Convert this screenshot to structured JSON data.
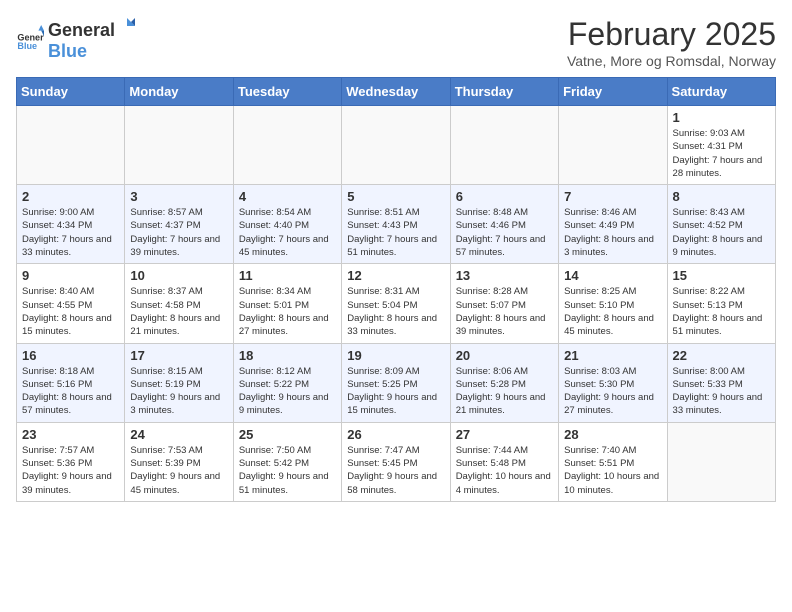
{
  "header": {
    "logo_general": "General",
    "logo_blue": "Blue",
    "month_title": "February 2025",
    "location": "Vatne, More og Romsdal, Norway"
  },
  "days_of_week": [
    "Sunday",
    "Monday",
    "Tuesday",
    "Wednesday",
    "Thursday",
    "Friday",
    "Saturday"
  ],
  "weeks": [
    [
      {
        "day": "",
        "info": ""
      },
      {
        "day": "",
        "info": ""
      },
      {
        "day": "",
        "info": ""
      },
      {
        "day": "",
        "info": ""
      },
      {
        "day": "",
        "info": ""
      },
      {
        "day": "",
        "info": ""
      },
      {
        "day": "1",
        "info": "Sunrise: 9:03 AM\nSunset: 4:31 PM\nDaylight: 7 hours and 28 minutes."
      }
    ],
    [
      {
        "day": "2",
        "info": "Sunrise: 9:00 AM\nSunset: 4:34 PM\nDaylight: 7 hours and 33 minutes."
      },
      {
        "day": "3",
        "info": "Sunrise: 8:57 AM\nSunset: 4:37 PM\nDaylight: 7 hours and 39 minutes."
      },
      {
        "day": "4",
        "info": "Sunrise: 8:54 AM\nSunset: 4:40 PM\nDaylight: 7 hours and 45 minutes."
      },
      {
        "day": "5",
        "info": "Sunrise: 8:51 AM\nSunset: 4:43 PM\nDaylight: 7 hours and 51 minutes."
      },
      {
        "day": "6",
        "info": "Sunrise: 8:48 AM\nSunset: 4:46 PM\nDaylight: 7 hours and 57 minutes."
      },
      {
        "day": "7",
        "info": "Sunrise: 8:46 AM\nSunset: 4:49 PM\nDaylight: 8 hours and 3 minutes."
      },
      {
        "day": "8",
        "info": "Sunrise: 8:43 AM\nSunset: 4:52 PM\nDaylight: 8 hours and 9 minutes."
      }
    ],
    [
      {
        "day": "9",
        "info": "Sunrise: 8:40 AM\nSunset: 4:55 PM\nDaylight: 8 hours and 15 minutes."
      },
      {
        "day": "10",
        "info": "Sunrise: 8:37 AM\nSunset: 4:58 PM\nDaylight: 8 hours and 21 minutes."
      },
      {
        "day": "11",
        "info": "Sunrise: 8:34 AM\nSunset: 5:01 PM\nDaylight: 8 hours and 27 minutes."
      },
      {
        "day": "12",
        "info": "Sunrise: 8:31 AM\nSunset: 5:04 PM\nDaylight: 8 hours and 33 minutes."
      },
      {
        "day": "13",
        "info": "Sunrise: 8:28 AM\nSunset: 5:07 PM\nDaylight: 8 hours and 39 minutes."
      },
      {
        "day": "14",
        "info": "Sunrise: 8:25 AM\nSunset: 5:10 PM\nDaylight: 8 hours and 45 minutes."
      },
      {
        "day": "15",
        "info": "Sunrise: 8:22 AM\nSunset: 5:13 PM\nDaylight: 8 hours and 51 minutes."
      }
    ],
    [
      {
        "day": "16",
        "info": "Sunrise: 8:18 AM\nSunset: 5:16 PM\nDaylight: 8 hours and 57 minutes."
      },
      {
        "day": "17",
        "info": "Sunrise: 8:15 AM\nSunset: 5:19 PM\nDaylight: 9 hours and 3 minutes."
      },
      {
        "day": "18",
        "info": "Sunrise: 8:12 AM\nSunset: 5:22 PM\nDaylight: 9 hours and 9 minutes."
      },
      {
        "day": "19",
        "info": "Sunrise: 8:09 AM\nSunset: 5:25 PM\nDaylight: 9 hours and 15 minutes."
      },
      {
        "day": "20",
        "info": "Sunrise: 8:06 AM\nSunset: 5:28 PM\nDaylight: 9 hours and 21 minutes."
      },
      {
        "day": "21",
        "info": "Sunrise: 8:03 AM\nSunset: 5:30 PM\nDaylight: 9 hours and 27 minutes."
      },
      {
        "day": "22",
        "info": "Sunrise: 8:00 AM\nSunset: 5:33 PM\nDaylight: 9 hours and 33 minutes."
      }
    ],
    [
      {
        "day": "23",
        "info": "Sunrise: 7:57 AM\nSunset: 5:36 PM\nDaylight: 9 hours and 39 minutes."
      },
      {
        "day": "24",
        "info": "Sunrise: 7:53 AM\nSunset: 5:39 PM\nDaylight: 9 hours and 45 minutes."
      },
      {
        "day": "25",
        "info": "Sunrise: 7:50 AM\nSunset: 5:42 PM\nDaylight: 9 hours and 51 minutes."
      },
      {
        "day": "26",
        "info": "Sunrise: 7:47 AM\nSunset: 5:45 PM\nDaylight: 9 hours and 58 minutes."
      },
      {
        "day": "27",
        "info": "Sunrise: 7:44 AM\nSunset: 5:48 PM\nDaylight: 10 hours and 4 minutes."
      },
      {
        "day": "28",
        "info": "Sunrise: 7:40 AM\nSunset: 5:51 PM\nDaylight: 10 hours and 10 minutes."
      },
      {
        "day": "",
        "info": ""
      }
    ]
  ]
}
